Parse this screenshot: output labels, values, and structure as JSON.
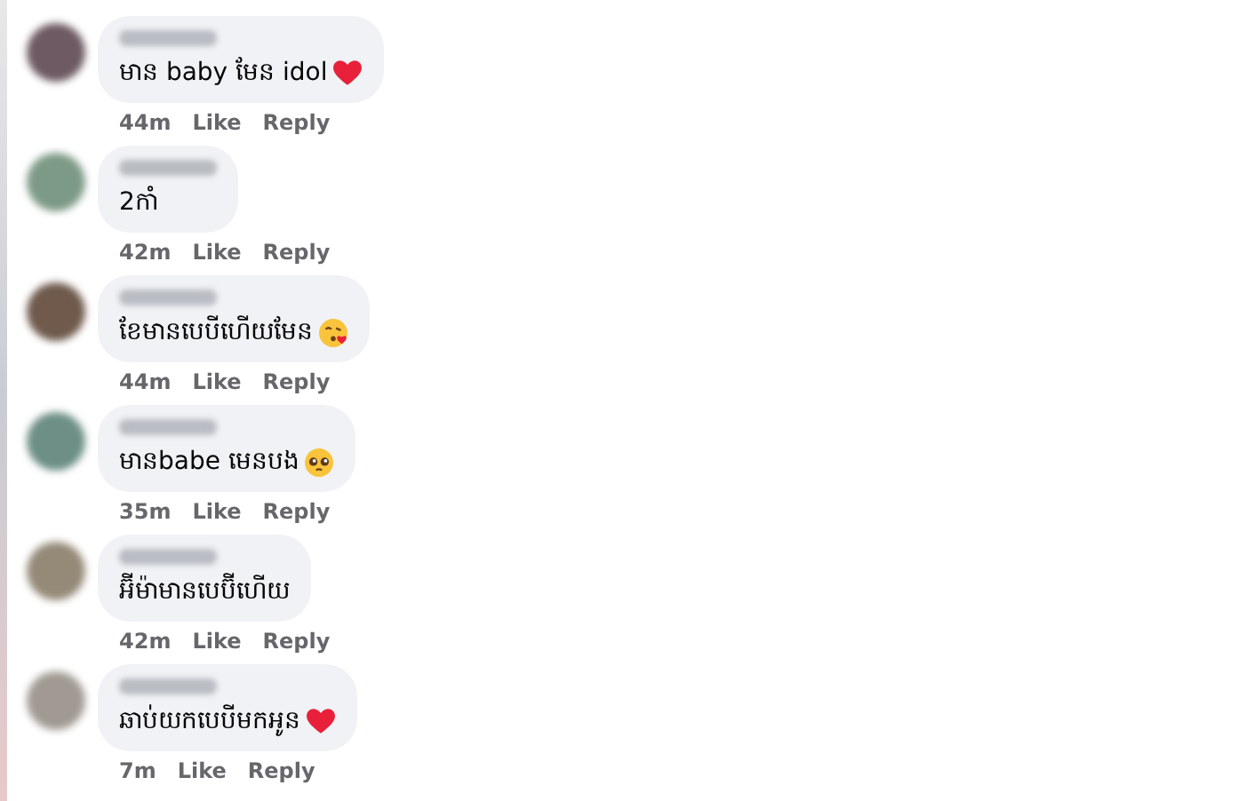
{
  "comments": [
    {
      "kind": "heart",
      "text": "មាន baby មែន idol",
      "time": "44m",
      "like": "Like",
      "reply": "Reply"
    },
    {
      "kind": "plain",
      "text": "2កាំ",
      "time": "42m",
      "like": "Like",
      "reply": "Reply"
    },
    {
      "kind": "kiss",
      "text": "ខែមានបេបីហើយមែន",
      "time": "44m",
      "like": "Like",
      "reply": "Reply"
    },
    {
      "kind": "pleading",
      "text": "មានbabe មេនបង",
      "time": "35m",
      "like": "Like",
      "reply": "Reply"
    },
    {
      "kind": "plain",
      "text": "អ៊ីម៉ាមានបេប៊ីហើយ",
      "time": "42m",
      "like": "Like",
      "reply": "Reply"
    },
    {
      "kind": "heart",
      "text": "ឆាប់យកបេបីមកអូន",
      "time": "7m",
      "like": "Like",
      "reply": "Reply"
    }
  ]
}
